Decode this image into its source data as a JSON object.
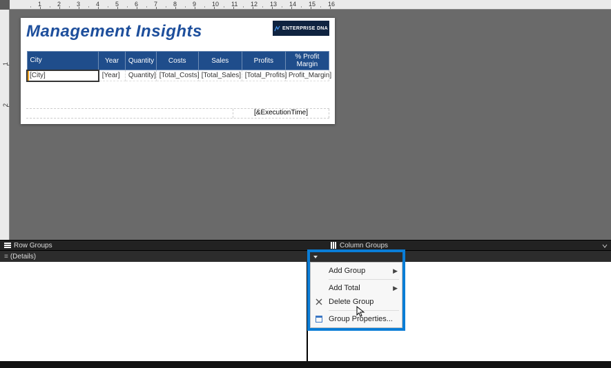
{
  "report": {
    "title": "Management Insights",
    "logo_text": "ENTERPRISE DNA",
    "columns": {
      "city": "City",
      "year": "Year",
      "quantity": "Quantity",
      "costs": "Costs",
      "sales": "Sales",
      "profits": "Profits",
      "margin": "% Profit Margin"
    },
    "fields": {
      "city": "[City]",
      "year": "[Year]",
      "quantity": "Quantity]",
      "costs": "[Total_Costs]",
      "sales": "[Total_Sales]",
      "profits": "[Total_Profits]",
      "margin": "Profit_Margin]"
    },
    "footer_exec_time": "[&ExecutionTime]"
  },
  "groups": {
    "row_label": "Row Groups",
    "col_label": "Column Groups",
    "details": "(Details)"
  },
  "ruler_h": [
    "1",
    "2",
    "3",
    "4",
    "5",
    "6",
    "7",
    "8",
    "9",
    "10",
    "11",
    "12",
    "13",
    "14",
    "15",
    "16"
  ],
  "ruler_v": [
    "1",
    "2"
  ],
  "context_menu": {
    "add_group": "Add Group",
    "add_total": "Add Total",
    "delete_group": "Delete Group",
    "group_properties": "Group Properties..."
  }
}
